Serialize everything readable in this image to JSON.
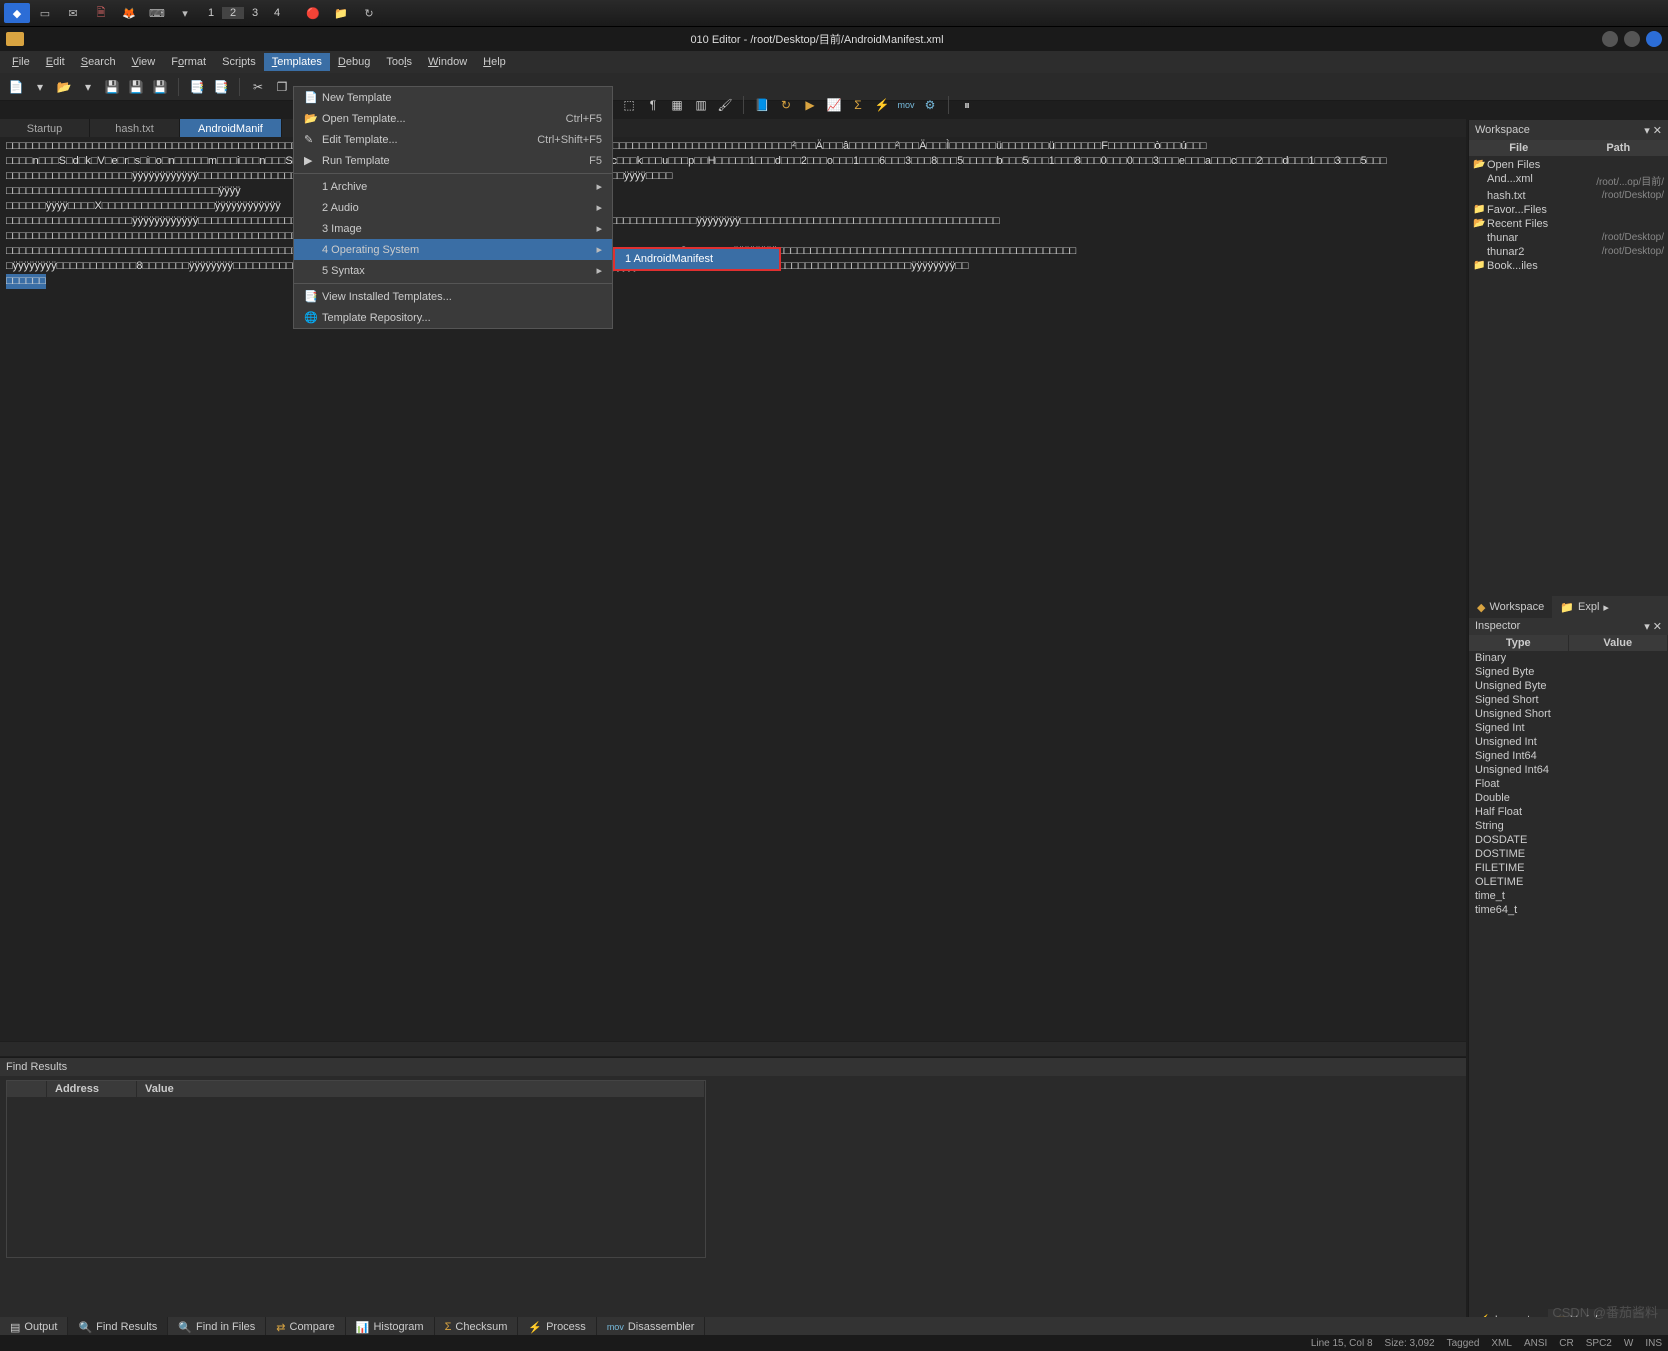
{
  "taskbar": {
    "workspaces": [
      "1",
      "2",
      "3",
      "4"
    ]
  },
  "titlebar": {
    "title": "010 Editor - /root/Desktop/目前/AndroidManifest.xml"
  },
  "menubar": {
    "items": [
      "File",
      "Edit",
      "Search",
      "View",
      "Format",
      "Scripts",
      "Templates",
      "Debug",
      "Tools",
      "Window",
      "Help"
    ],
    "active_index": 6
  },
  "tabs": {
    "items": [
      "Startup",
      "hash.txt",
      "AndroidManifest.xml"
    ],
    "active_index": 2,
    "active_display": "AndroidManif"
  },
  "templates_menu": {
    "items": [
      {
        "icon": "📄",
        "label": "New Template",
        "shortcut": ""
      },
      {
        "icon": "📂",
        "label": "Open Template...",
        "shortcut": "Ctrl+F5"
      },
      {
        "icon": "✎",
        "label": "Edit Template...",
        "shortcut": "Ctrl+Shift+F5"
      },
      {
        "icon": "▶",
        "label": "Run Template",
        "shortcut": "F5"
      },
      {
        "sep": true
      },
      {
        "icon": "",
        "label": "1 Archive",
        "arrow": true
      },
      {
        "icon": "",
        "label": "2 Audio",
        "arrow": true
      },
      {
        "icon": "",
        "label": "3 Image",
        "arrow": true
      },
      {
        "icon": "",
        "label": "4 Operating System",
        "arrow": true,
        "hover": true
      },
      {
        "icon": "",
        "label": "5 Syntax",
        "arrow": true
      },
      {
        "sep": true
      },
      {
        "icon": "📑",
        "label": "View Installed Templates...",
        "shortcut": ""
      },
      {
        "icon": "🌐",
        "label": "Template Repository...",
        "shortcut": ""
      }
    ]
  },
  "submenu": {
    "label": "1 AndroidManifest"
  },
  "workspace": {
    "title": "Workspace",
    "cols": [
      "File",
      "Path"
    ],
    "tree": [
      {
        "type": "folder",
        "label": "Open Files"
      },
      {
        "type": "file",
        "label": "And...xml",
        "path": "/root/...op/目前/"
      },
      {
        "type": "file",
        "label": "hash.txt",
        "path": "/root/Desktop/"
      },
      {
        "type": "folder",
        "label": "Favor...Files"
      },
      {
        "type": "folder",
        "label": "Recent Files"
      },
      {
        "type": "file",
        "label": "thunar",
        "path": "/root/Desktop/"
      },
      {
        "type": "file",
        "label": "thunar2",
        "path": "/root/Desktop/"
      },
      {
        "type": "folder",
        "label": "Book...iles"
      }
    ]
  },
  "workspace_tabs": [
    "Workspace",
    "Expl"
  ],
  "inspector": {
    "title": "Inspector",
    "cols": [
      "Type",
      "Value"
    ],
    "rows": [
      "Binary",
      "Signed Byte",
      "Unsigned Byte",
      "Signed Short",
      "Unsigned Short",
      "Signed Int",
      "Unsigned Int",
      "Signed Int64",
      "Unsigned Int64",
      "Float",
      "Double",
      "Half Float",
      "String",
      "DOSDATE",
      "DOSTIME",
      "FILETIME",
      "OLETIME",
      "time_t",
      "time64_t"
    ]
  },
  "inspector_tabs": [
    "Inspector",
    "Variab"
  ],
  "find_results": {
    "title": "Find Results",
    "cols": [
      "",
      "Address",
      "Value"
    ]
  },
  "bottom_tabs": [
    "Output",
    "Find Results",
    "Find in Files",
    "Compare",
    "Histogram",
    "Checksum",
    "Process",
    "Disassembler"
  ],
  "bottom_active": 1,
  "statusbar": {
    "pos": "Line 15, Col 8",
    "size": "Size: 3,092",
    "tags": [
      "Tagged",
      "XML",
      "ANSI",
      "CR",
      "SPC2",
      "W",
      "INS"
    ]
  },
  "watermark": "CSDN @番茄酱料",
  "editor_placeholder": "□"
}
